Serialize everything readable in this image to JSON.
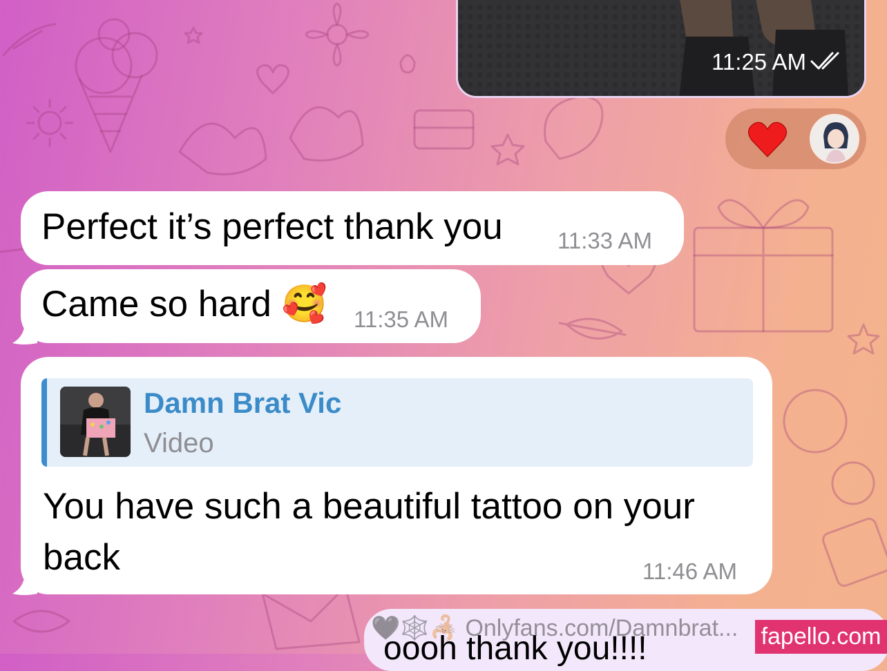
{
  "colors": {
    "bubble_in": "#ffffff",
    "bubble_out": "#f3e7fb",
    "timestamp": "#8e8e93",
    "reply_accent": "#3c8cd0",
    "reply_name": "#3a8bc8",
    "reply_bg": "#e5eff9",
    "watermark_bg": "#e0336f"
  },
  "media_message": {
    "time": "11:25 AM",
    "status_icon": "double-check-icon"
  },
  "reaction": {
    "emoji": "❤️",
    "avatar_icon": "anime-avatar-icon"
  },
  "messages": [
    {
      "text": "Perfect it’s perfect thank you",
      "time": "11:33 AM"
    },
    {
      "text": "Came so hard 🥰",
      "time": "11:35 AM"
    }
  ],
  "reply_message": {
    "quote_name": "Damn Brat Vic",
    "quote_type": "Video",
    "text_line1": "You have such a beautiful tattoo on your",
    "text_line2": "back",
    "time": "11:46 AM"
  },
  "outgoing_partial": {
    "watermark_text": "🖤🕸️🦂 Onlyfans.com/Damnbrat...",
    "text": "oooh thank you!!!!"
  },
  "site_watermark": "fapello.com"
}
